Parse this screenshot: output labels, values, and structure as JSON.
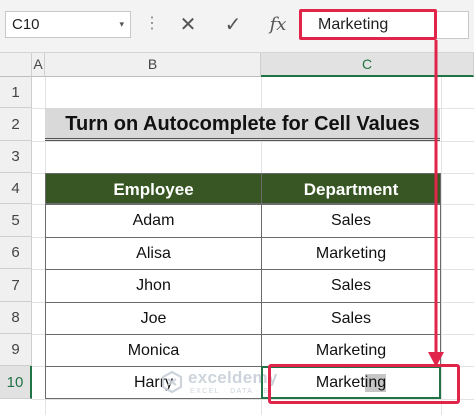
{
  "formula_bar": {
    "name_box": "C10",
    "name_box_arrow": "▾",
    "separator": "⋮",
    "cancel_glyph": "✕",
    "enter_glyph": "✓",
    "fx_glyph": "fx",
    "formula_value": "Marketing"
  },
  "columns": [
    "A",
    "B",
    "C"
  ],
  "rows": [
    "1",
    "2",
    "3",
    "4",
    "5",
    "6",
    "7",
    "8",
    "9",
    "10"
  ],
  "title": "Turn on Autocomplete for Cell Values",
  "table": {
    "headers": [
      "Employee",
      "Department"
    ],
    "rows": [
      {
        "employee": "Adam",
        "department": "Sales"
      },
      {
        "employee": "Alisa",
        "department": "Marketing"
      },
      {
        "employee": "Jhon",
        "department": "Sales"
      },
      {
        "employee": "Joe",
        "department": "Sales"
      },
      {
        "employee": "Monica",
        "department": "Marketing"
      },
      {
        "employee": "Harry",
        "department_typed": "Market",
        "department_suggested": "ing"
      }
    ]
  },
  "watermark": {
    "name": "exceldemy",
    "tagline": "EXCEL · DATA · BI"
  },
  "colors": {
    "header_green": "#375623",
    "highlight_red": "#e0244a",
    "excel_green": "#217346",
    "title_gray": "#d9d9d9"
  }
}
